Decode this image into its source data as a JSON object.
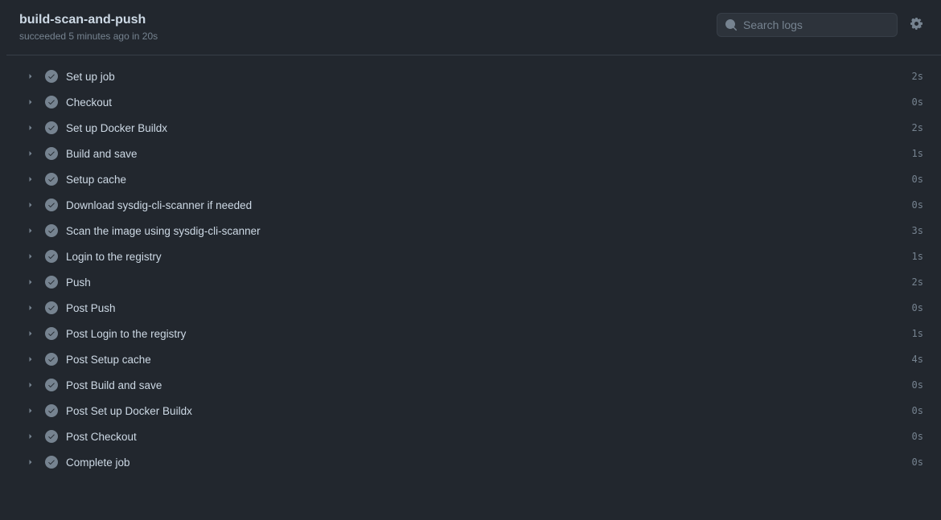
{
  "header": {
    "title": "build-scan-and-push",
    "subtitle": "succeeded 5 minutes ago in 20s"
  },
  "search": {
    "placeholder": "Search logs"
  },
  "steps": [
    {
      "name": "Set up job",
      "duration": "2s"
    },
    {
      "name": "Checkout",
      "duration": "0s"
    },
    {
      "name": "Set up Docker Buildx",
      "duration": "2s"
    },
    {
      "name": "Build and save",
      "duration": "1s"
    },
    {
      "name": "Setup cache",
      "duration": "0s"
    },
    {
      "name": "Download sysdig-cli-scanner if needed",
      "duration": "0s"
    },
    {
      "name": "Scan the image using sysdig-cli-scanner",
      "duration": "3s"
    },
    {
      "name": "Login to the registry",
      "duration": "1s"
    },
    {
      "name": "Push",
      "duration": "2s"
    },
    {
      "name": "Post Push",
      "duration": "0s"
    },
    {
      "name": "Post Login to the registry",
      "duration": "1s"
    },
    {
      "name": "Post Setup cache",
      "duration": "4s"
    },
    {
      "name": "Post Build and save",
      "duration": "0s"
    },
    {
      "name": "Post Set up Docker Buildx",
      "duration": "0s"
    },
    {
      "name": "Post Checkout",
      "duration": "0s"
    },
    {
      "name": "Complete job",
      "duration": "0s"
    }
  ]
}
